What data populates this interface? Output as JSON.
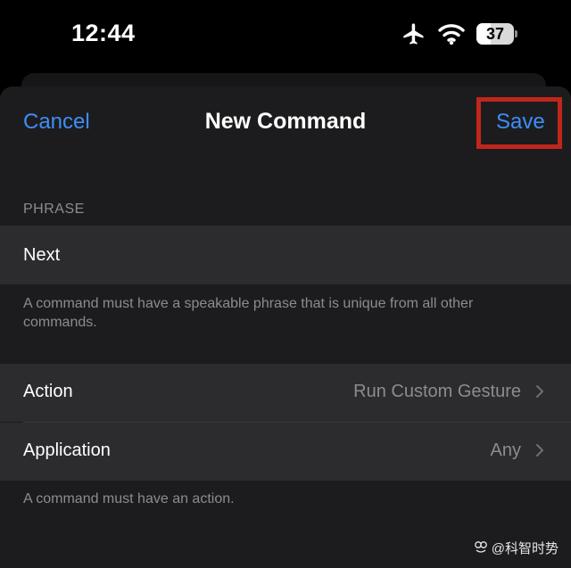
{
  "status_bar": {
    "time": "12:44",
    "battery_level": "37",
    "icons": [
      "airplane-icon",
      "wifi-icon",
      "battery-icon"
    ]
  },
  "nav": {
    "cancel_label": "Cancel",
    "title": "New Command",
    "save_label": "Save"
  },
  "phrase_section": {
    "header": "PHRASE",
    "value": "Next",
    "placeholder": "",
    "footer": "A command must have a speakable phrase that is unique from all other commands."
  },
  "action_section": {
    "rows": [
      {
        "label": "Action",
        "value": "Run Custom Gesture"
      },
      {
        "label": "Application",
        "value": "Any"
      }
    ],
    "footer": "A command must have an action."
  },
  "watermark": {
    "text": "@科智时势"
  },
  "colors": {
    "accent": "#3e8ef7",
    "highlight_box": "#c0261c",
    "sheet_background": "#1c1c1e",
    "cell_background": "#2c2c2e",
    "secondary_text": "#8c8c90"
  }
}
